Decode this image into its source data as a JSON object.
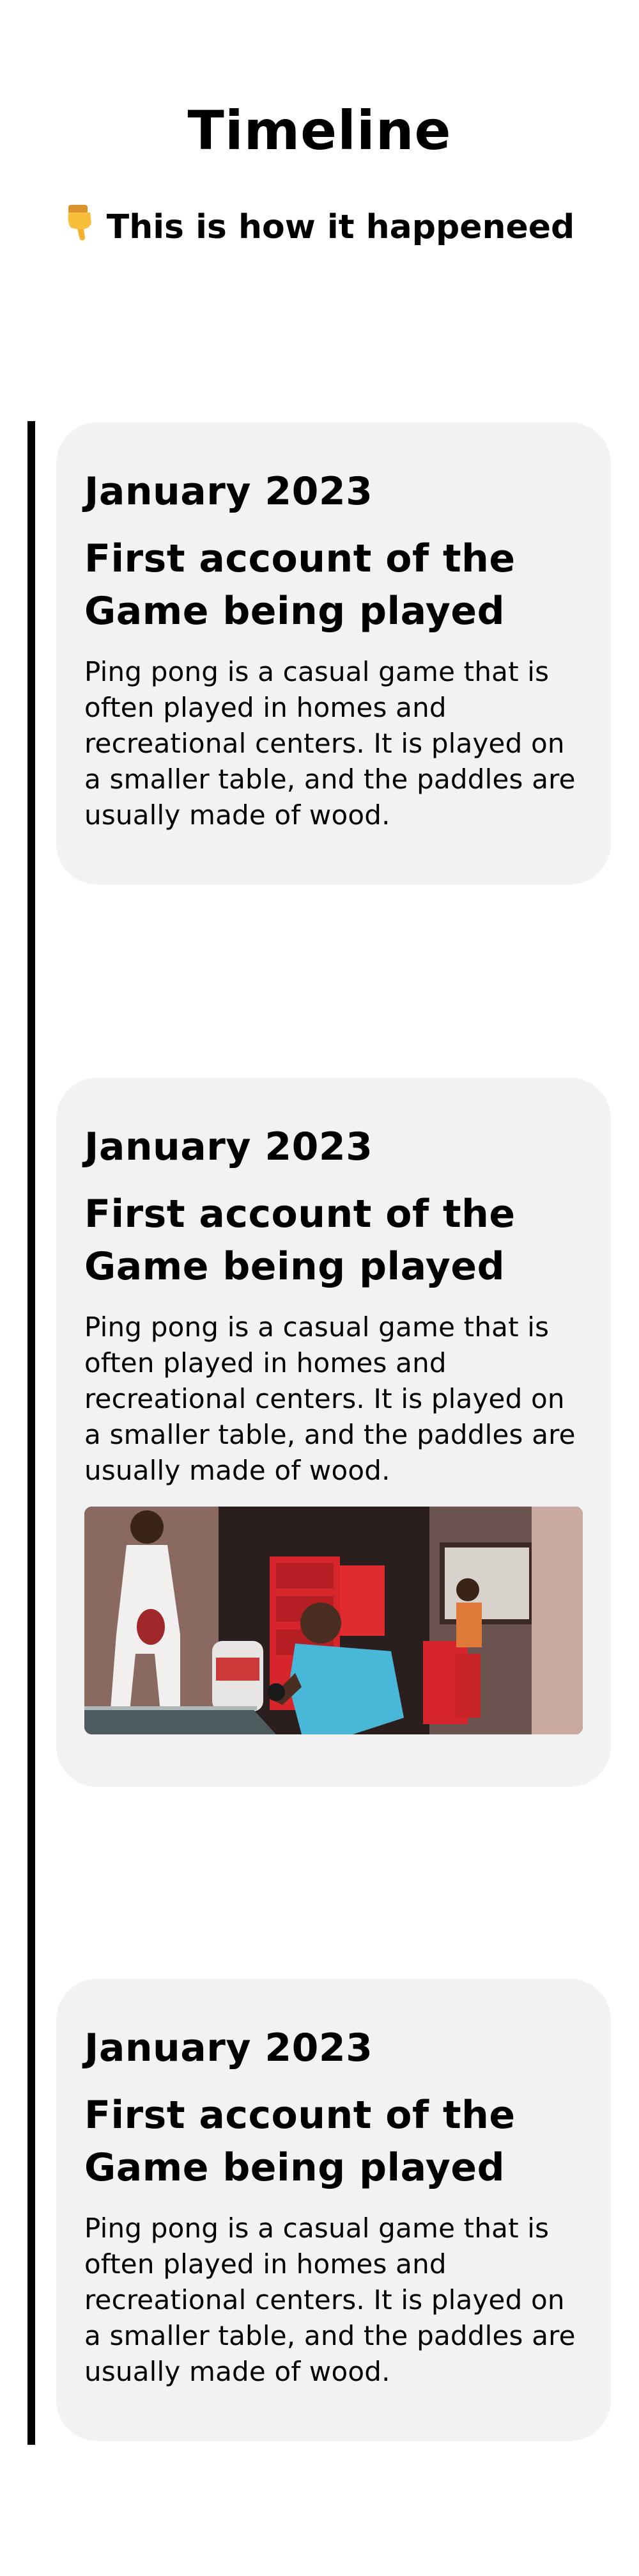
{
  "header": {
    "title": "Timeline",
    "subtitle": "This is how it happeneed",
    "subtitle_icon": "pointing-down-hand-icon"
  },
  "timeline": {
    "line_color": "#000000",
    "card_background": "#f2f2f2",
    "items": [
      {
        "date": "January 2023",
        "heading": "First account of the Game being played",
        "text": "Ping pong is a casual game that is often played in homes and recreational centers. It is played on a smaller table, and the paddles are usually made of wood.",
        "has_image": false
      },
      {
        "date": "January 2023",
        "heading": "First account of the Game being played",
        "text": "Ping pong is a casual game that is often played in homes and recreational centers. It is played on a smaller table, and the paddles are usually made of wood.",
        "has_image": true,
        "image_subject": "ping-pong-players-photo"
      },
      {
        "date": "January 2023",
        "heading": "First account of the Game being played",
        "text": "Ping pong is a casual game that is often played in homes and recreational centers. It is played on a smaller table, and the paddles are usually made of wood.",
        "has_image": false
      }
    ]
  }
}
